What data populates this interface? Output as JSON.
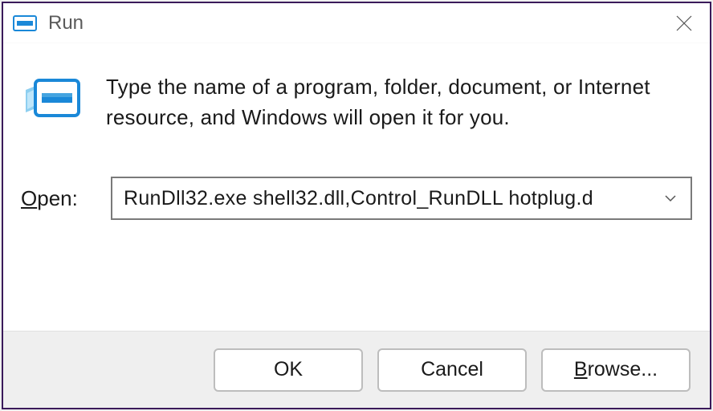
{
  "window": {
    "title": "Run"
  },
  "description": "Type the name of a program, folder, document, or Internet resource, and Windows will open it for you.",
  "open": {
    "label_pre": "O",
    "label_rest": "pen:",
    "value": "RunDll32.exe shell32.dll,Control_RunDLL hotplug.d"
  },
  "buttons": {
    "ok": "OK",
    "cancel": "Cancel",
    "browse_pre": "B",
    "browse_rest": "rowse..."
  }
}
